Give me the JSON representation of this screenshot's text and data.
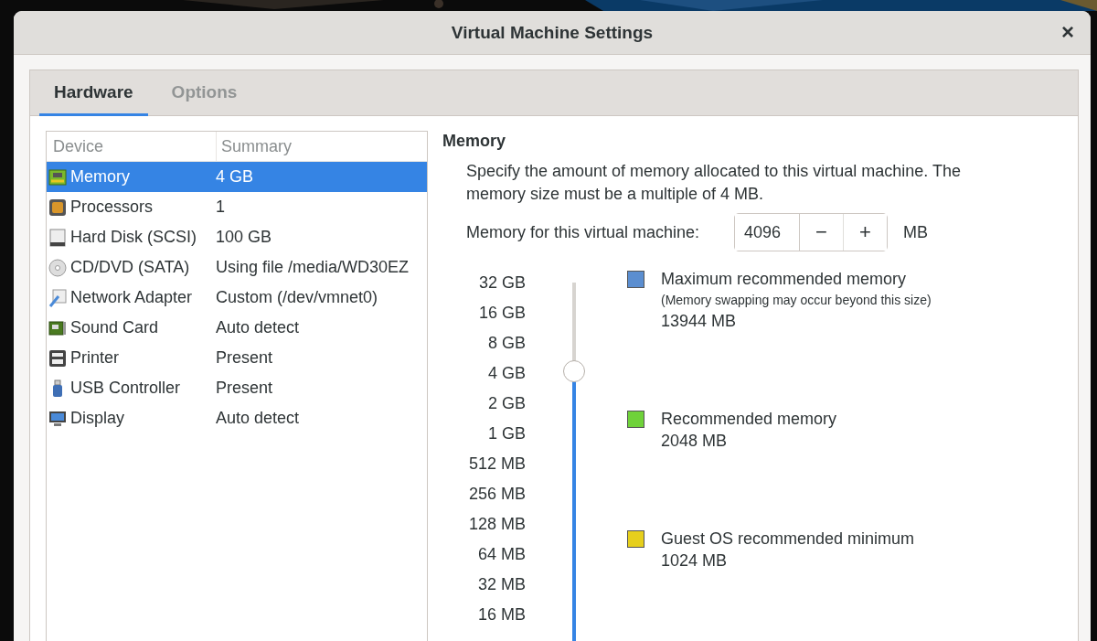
{
  "window": {
    "title": "Virtual Machine Settings",
    "close": "×"
  },
  "tabs": [
    {
      "label": "Hardware",
      "selected": true
    },
    {
      "label": "Options",
      "selected": false
    }
  ],
  "devices": {
    "columns": [
      "Device",
      "Summary"
    ],
    "rows": [
      {
        "kind": "memory",
        "device": "Memory",
        "summary": "4 GB",
        "selected": true
      },
      {
        "kind": "processor",
        "device": "Processors",
        "summary": "1",
        "selected": false
      },
      {
        "kind": "disk",
        "device": "Hard Disk (SCSI)",
        "summary": "100 GB",
        "selected": false
      },
      {
        "kind": "cd",
        "device": "CD/DVD (SATA)",
        "summary": "Using file /media/WD30EZ",
        "selected": false
      },
      {
        "kind": "network",
        "device": "Network Adapter",
        "summary": "Custom (/dev/vmnet0)",
        "selected": false
      },
      {
        "kind": "sound",
        "device": "Sound Card",
        "summary": "Auto detect",
        "selected": false
      },
      {
        "kind": "printer",
        "device": "Printer",
        "summary": "Present",
        "selected": false
      },
      {
        "kind": "usb",
        "device": "USB Controller",
        "summary": "Present",
        "selected": false
      },
      {
        "kind": "display",
        "device": "Display",
        "summary": "Auto detect",
        "selected": false
      }
    ]
  },
  "memory": {
    "heading": "Memory",
    "description": "Specify the amount of memory allocated to this virtual machine. The memory size must be a multiple of 4 MB.",
    "field_label": "Memory for this virtual machine:",
    "value": "4096",
    "minus": "−",
    "plus": "+",
    "unit": "MB",
    "slider": {
      "level": 0.79,
      "labels": [
        "32 GB",
        "16 GB",
        "8 GB",
        "4 GB",
        "2 GB",
        "1 GB",
        "512 MB",
        "256 MB",
        "128 MB",
        "64 MB",
        "32 MB",
        "16 MB"
      ]
    },
    "legend": [
      {
        "color": "#5b8ed0",
        "title": "Maximum recommended memory",
        "note": "(Memory swapping may occur beyond this size)",
        "value": "13944 MB"
      },
      {
        "color": "#6fd23a",
        "title": "Recommended memory",
        "value": "2048 MB"
      },
      {
        "color": "#e6cf1c",
        "title": "Guest OS recommended minimum",
        "value": "1024 MB"
      }
    ]
  }
}
